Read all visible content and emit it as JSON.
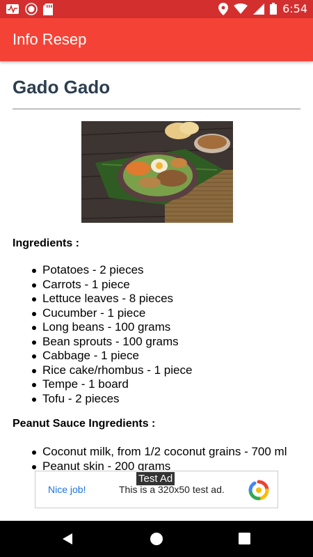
{
  "status_bar": {
    "time": "6:54",
    "left_icons": [
      "activity-monitor-icon",
      "record-icon",
      "sd-card-icon"
    ],
    "right_icons": [
      "location-icon",
      "wifi-icon",
      "signal-icon",
      "battery-icon"
    ]
  },
  "app_bar": {
    "title": "Info Resep",
    "color": "#f44336"
  },
  "recipe": {
    "title": "Gado Gado",
    "image_alt": "Gado Gado dish on banana leaf",
    "ingredients_heading": "Ingredients :",
    "ingredients": [
      "Potatoes - 2 pieces",
      "Carrots - 1 piece",
      "Lettuce leaves - 8 pieces",
      "Cucumber - 1 piece",
      "Long beans - 100 grams",
      "Bean sprouts - 100 grams",
      "Cabbage - 1 piece",
      "Rice cake/rhombus - 1 piece",
      "Tempe - 1 board",
      "Tofu - 2 pieces"
    ],
    "sauce_heading": "Peanut Sauce Ingredients :",
    "sauce_ingredients": [
      "Coconut milk, from 1/2 coconut grains - 700 ml",
      "Peanut skin - 200 grams"
    ]
  },
  "ad": {
    "label": "Test Ad",
    "nice": "Nice job!",
    "text": "This is a 320x50 test ad."
  },
  "nav_bar": {
    "icons": [
      "back-icon",
      "home-icon",
      "recents-icon"
    ]
  }
}
